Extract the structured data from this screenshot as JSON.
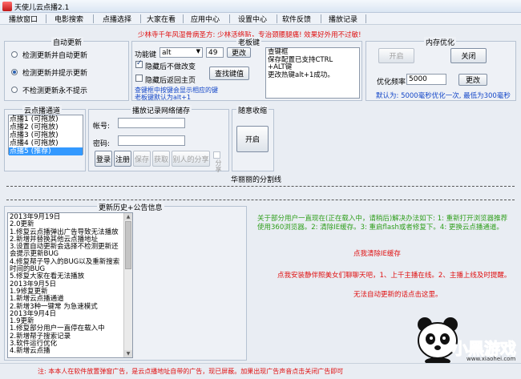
{
  "window": {
    "title": "天使儿云点播2.1"
  },
  "menu": [
    {
      "label": "播放窗口"
    },
    {
      "label": "电影搜索"
    },
    {
      "label": "点播选择"
    },
    {
      "label": "大家在看"
    },
    {
      "label": "应用中心"
    },
    {
      "label": "设置中心"
    },
    {
      "label": "软件反馈"
    },
    {
      "label": "播放记录"
    }
  ],
  "banner": "少林寺千年风湿骨病圣方: 少林活络贴，专治颈腰腿痛! 效果好外用不过敏!",
  "auto_update": {
    "title": "自动更新",
    "options": [
      "检测更新并自动更新",
      "检测更新并提示更新",
      "不检测更新永不提示"
    ],
    "selected": 1
  },
  "boss_key": {
    "title": "老板键",
    "hotkey_label": "功能键",
    "hotkey_value": "alt",
    "key_value": "49",
    "change_label": "更改",
    "hide_no_change": "隐藏后不做改变",
    "hide_to_home": "隐藏后返回主页",
    "find_button": "查找键值",
    "hint_line1": "查键框中按键会显示相应的键",
    "hint_line2": "老板键默认为alt+1",
    "log": [
      "查键框",
      "保存配置已支持CTRL",
      "+ALT键",
      "更改热键alt+1成功。"
    ]
  },
  "memory": {
    "title": "内存优化",
    "open_label": "开启",
    "close_label": "关闭",
    "freq_label": "优化频率:",
    "freq_value": "5000",
    "change_label": "更改",
    "info": "默认为: 5000毫秒优化一次, 最低为300毫秒"
  },
  "cloud_channels": {
    "title": "云点播通道",
    "items": [
      "点播1 (可拖放)",
      "点播2 (可拖放)",
      "点播3 (可拖放)",
      "点播4 (可拖放)",
      "点播5 (推荐)"
    ],
    "selected": 4
  },
  "play_records": {
    "title": "播放记录网络储存",
    "account_label": "帐号:",
    "password_label": "密码:",
    "login": "登录",
    "register": "注册",
    "save": "保存",
    "fetch": "获取",
    "others": "别人的分享",
    "share": "分享"
  },
  "random": {
    "title": "随意收缩",
    "open_label": "开启"
  },
  "divider_label": "华丽丽的分割线",
  "history": {
    "title": "更新历史+公告信息",
    "lines": [
      "2013年9月19日",
      "2.0更新",
      "1.修复云点播弹出广告导致无法播放",
      "2.新增并替换其他云点播地址",
      "3.设置自动更新会选择不检测更新还",
      "会提示更新BUG",
      "4.修复帮子导入的BUG以及重新搜索",
      "时间的BUG",
      "5.修复大家在看无法播放",
      "2013年9月5日",
      "1.9修复更新",
      "1.新增云点播通道",
      "2.新增3种一键常 为急速模式",
      "2013年9月4日",
      "1.9更新",
      "1.修复部分用户一直停在载入中",
      "2.新增帮子搜索记录",
      "3.软件运行优化",
      "4.新增云点播"
    ]
  },
  "notices": {
    "green": "关于部分用户一直现在(正在载入中，请稍后)解决办法如下: 1: 重新打开浏览器推荐使用360浏览器。2: 清除IE缓存。3: 重启flash或者修复下。4: 更换云点播通道。",
    "red1": "点我清除IE缓存",
    "red2": "点我安装静伴照美女们聊聊天吧，1、上千主播在线。2、主播上线及时提醒。",
    "red3": "无法自动更新的话点击这里。"
  },
  "footer": "注: 本本人在软件放置弹窗广告，是云点播地址自带的广告，现已屏蔽。加果出现广告声音点击关闭广告即可",
  "watermark": {
    "name": "小黑游戏",
    "url": "www.xiaohei.com"
  }
}
